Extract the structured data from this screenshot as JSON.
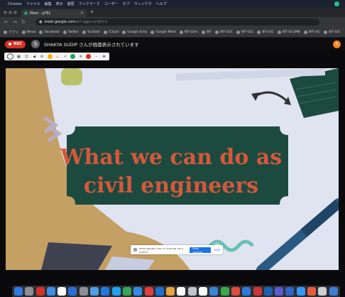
{
  "menubar": {
    "items": [
      "Chrome",
      "ファイル",
      "編集",
      "表示",
      "履歴",
      "ブックマーク",
      "ユーザー",
      "タブ",
      "ウィンドウ",
      "ヘルプ"
    ]
  },
  "browser": {
    "tab_title": "Meet - gYEL",
    "new_tab": "+",
    "tab_close": "×",
    "url_host": "meet.google.com",
    "url_path": "/ert-qgpx-yi?pli=1",
    "bookmarks": [
      "アプリ",
      "Nihao",
      "Facebook",
      "Twitter",
      "YouTube",
      "iCloud",
      "Google Scho",
      "Google Meet",
      "BIT-Gimi",
      "BIT",
      "BIT-GCE",
      "BIT-GEL",
      "BIT-GIC",
      "BIT-SCGMB",
      "BIT-GIC",
      "BIT-GIC"
    ]
  },
  "meet": {
    "rec_label": "REC",
    "presenter_initial": "S",
    "presenting_text": "SHAKYA SUDIP さんが画面表示されています",
    "orange_ext_label": "R",
    "share_banner_text": "meet.google.com is sharing your screen.",
    "stop_sharing_label": "Stop sharing",
    "hide_label": "Hide"
  },
  "slide": {
    "title_line1": "What we can do as",
    "title_line2": "civil engineers"
  },
  "colors": {
    "slide_title": "#d4583c",
    "board": "#1d4a3f",
    "paper": "#dfe4f0",
    "rec": "#d93025",
    "accent_blue": "#1a73e8"
  },
  "ext_toolbar_icons": [
    "circle-icon",
    "eye-icon",
    "mask-icon",
    "speaker-icon",
    "gear-icon",
    "smile-icon",
    "home-icon",
    "share-icon",
    "green-dot-icon",
    "settings-icon",
    "red-dot-icon",
    "minimize-icon",
    "move-icon"
  ],
  "dock_icon_colors": [
    "#2d7be5",
    "#8e8e93",
    "#d6312a",
    "#3a8ee6",
    "#ffffff",
    "#2b6fd6",
    "#8e8e93",
    "#4aa1ea",
    "#1f7ae0",
    "#1da1f2",
    "#34a853",
    "#2f8ce6",
    "#e43c3c",
    "#1e6fd0",
    "#e8a33d",
    "#ffffff",
    "#c3c3c9",
    "#ffffff",
    "#3a85d8",
    "#39a84b",
    "#e04a3a",
    "#2c78dd",
    "#cc3535",
    "#1e5fb0",
    "#5b5bd6",
    "#2f64c7",
    "#3399ff",
    "#e75d3a",
    "#d0d0d0",
    "#3e7cd6"
  ]
}
